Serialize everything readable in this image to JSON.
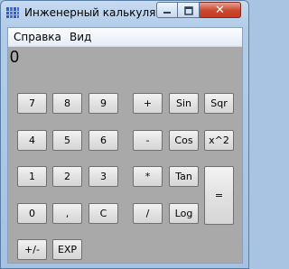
{
  "window": {
    "title": "Инженерный калькуля..."
  },
  "menu": {
    "items": [
      "Справка",
      "Вид"
    ]
  },
  "display": {
    "value": "0"
  },
  "keys": {
    "k7": "7",
    "k8": "8",
    "k9": "9",
    "plus": "+",
    "sin": "Sin",
    "sqr": "Sqr",
    "k4": "4",
    "k5": "5",
    "k6": "6",
    "minus": "-",
    "cos": "Cos",
    "x2": "x^2",
    "k1": "1",
    "k2": "2",
    "k3": "3",
    "mul": "*",
    "tan": "Tan",
    "eq": "=",
    "k0": "0",
    "comma": ",",
    "clear": "C",
    "div": "/",
    "log": "Log",
    "sign": "+/-",
    "exp": "EXP"
  },
  "icons": {
    "app": "calculator-app-icon",
    "minimize": "minimize-icon",
    "maximize": "maximize-icon",
    "close": "close-icon"
  },
  "colors": {
    "display_bg": "#a9a9a9",
    "close_button": "#c9462c"
  }
}
